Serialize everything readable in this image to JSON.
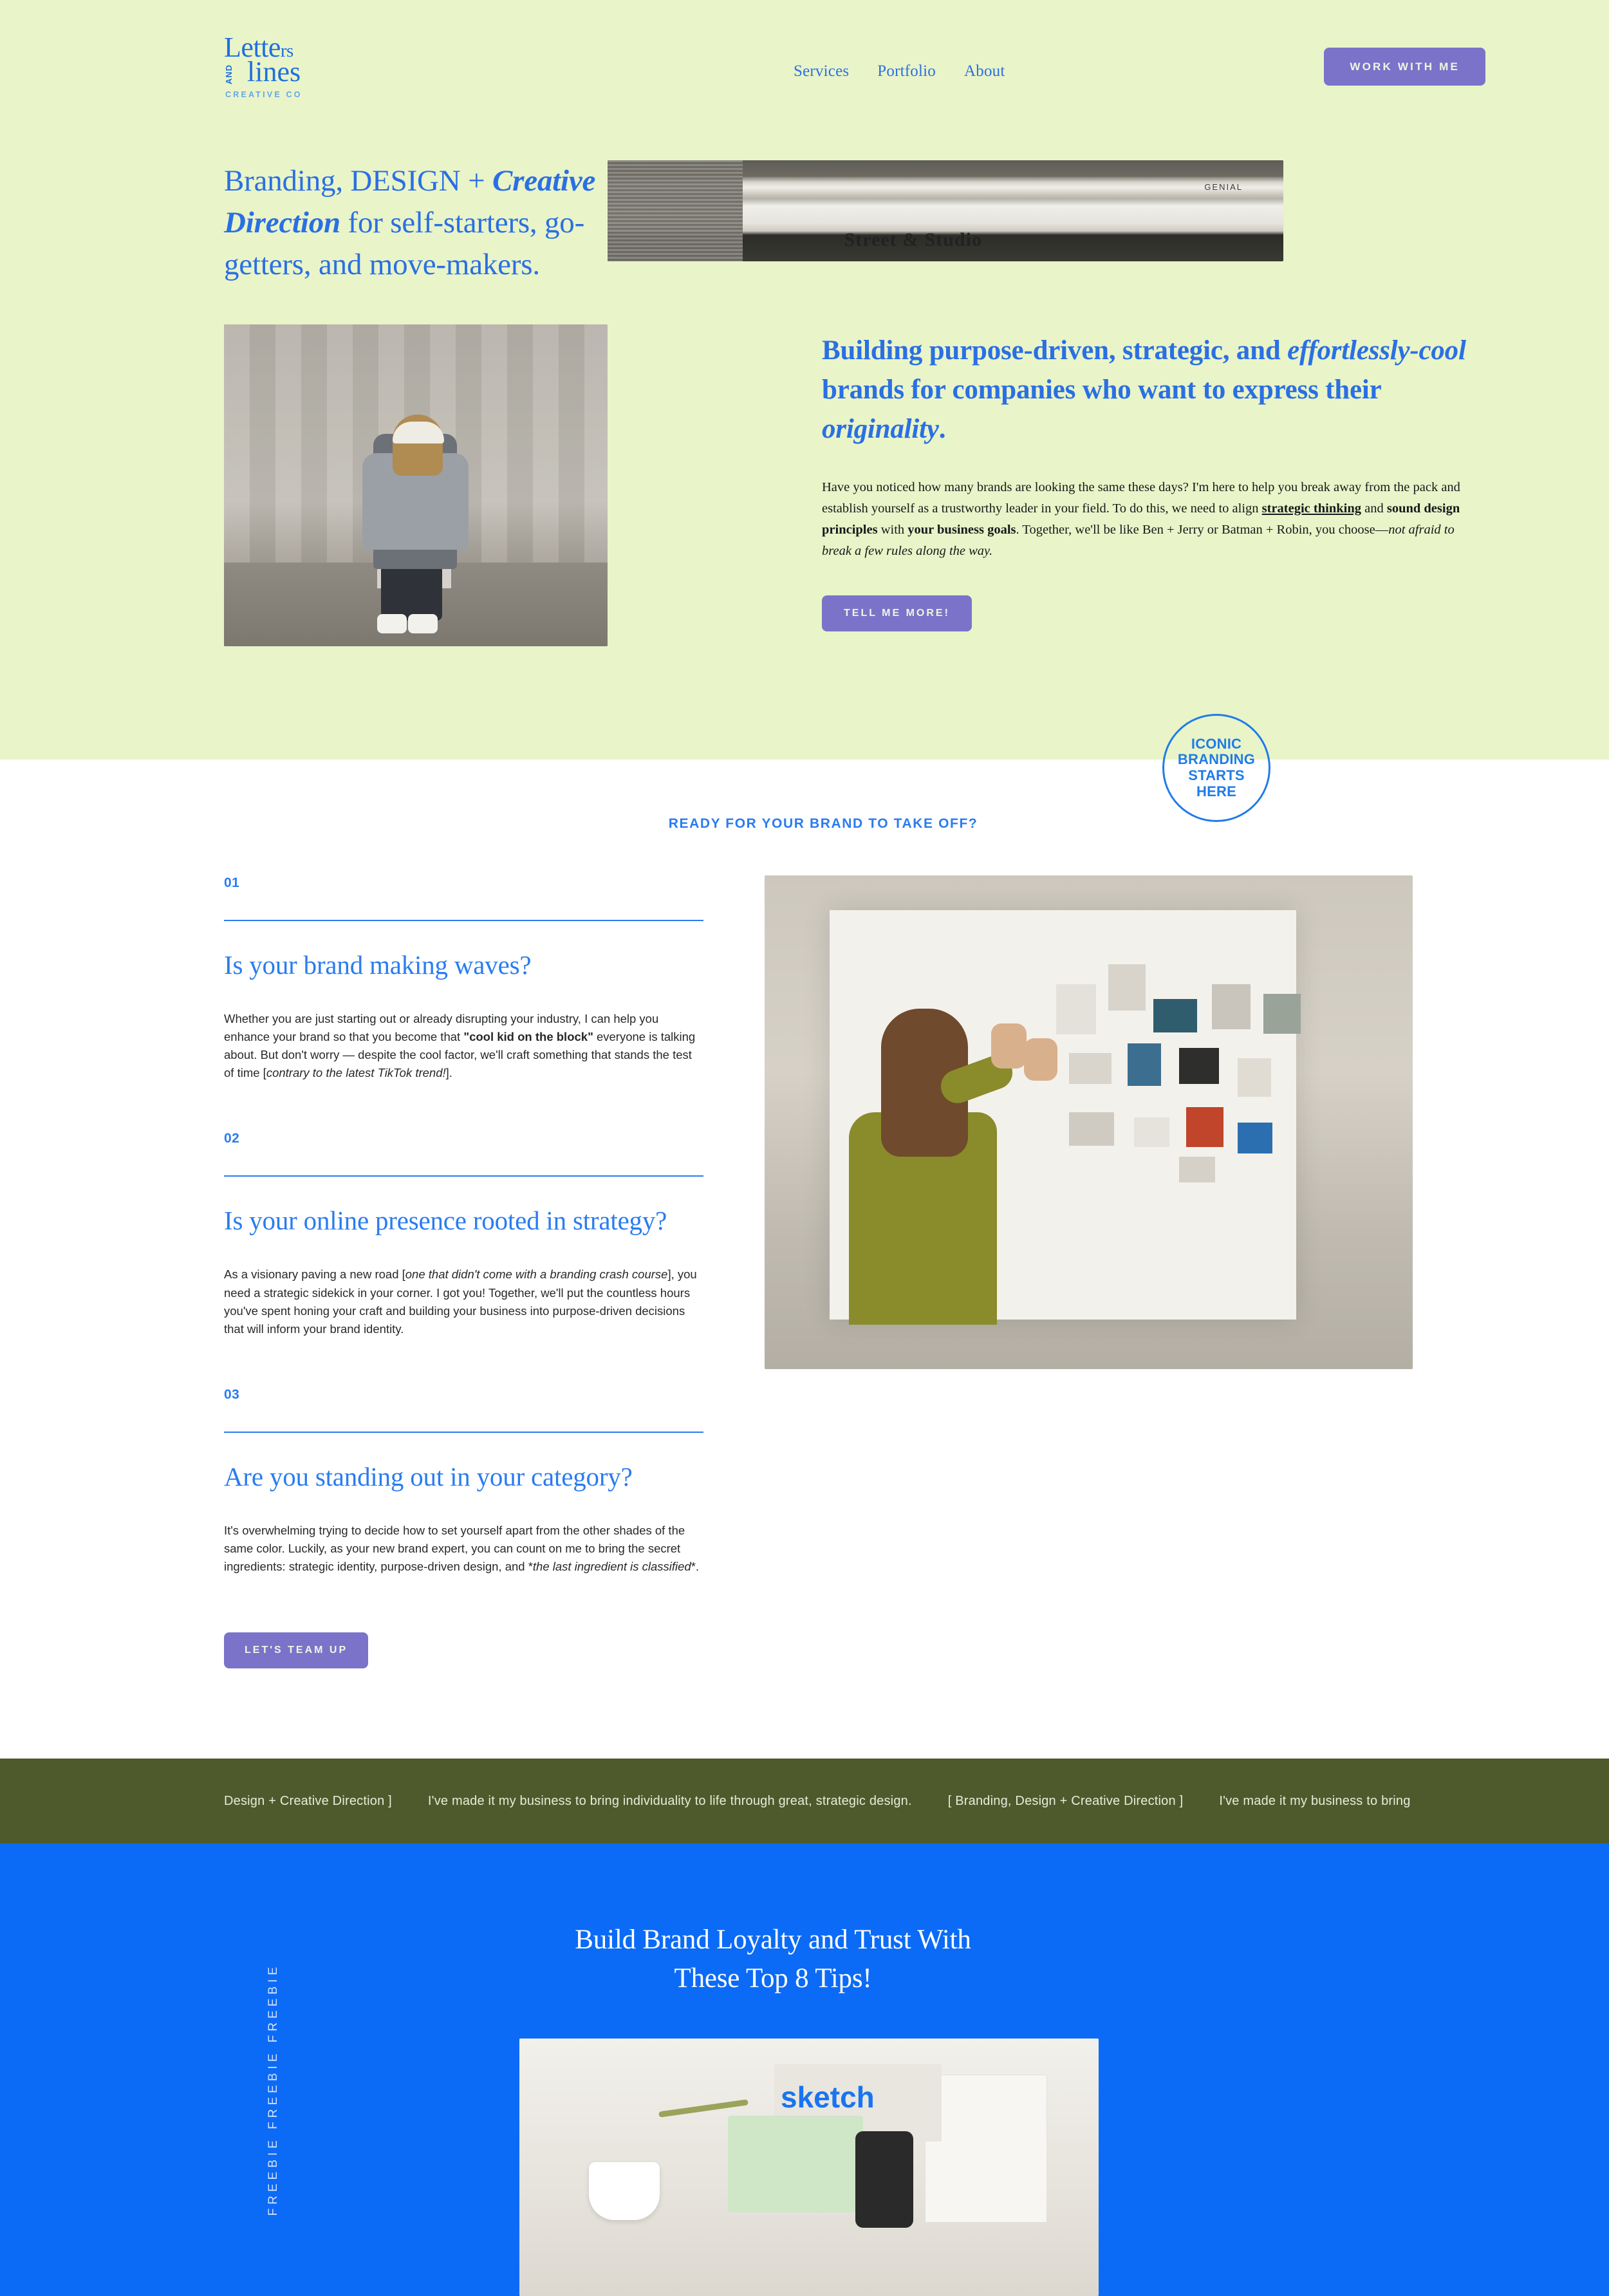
{
  "colors": {
    "hero_bg": "#e9f4c8",
    "brand_blue": "#2a6fe4",
    "bright_blue": "#0b6bf7",
    "purple_button": "#7b73c9",
    "olive_bar": "#4e5a2c",
    "white": "#ffffff"
  },
  "header": {
    "logo": {
      "line1": "Lette",
      "line1_small": "rs",
      "and": "AND",
      "line2": "lines",
      "subtitle": "CREATIVE CO"
    },
    "nav": [
      {
        "label": "Services"
      },
      {
        "label": "Portfolio"
      },
      {
        "label": "About"
      }
    ],
    "cta": "WORK WITH ME"
  },
  "hero": {
    "headline_part1": "Branding, DESIGN + ",
    "headline_italic1": "Creative Direction",
    "headline_part2": " for self-starters, go-getters, and move-makers.",
    "image_top_label": "Street & Studio",
    "image_top_label2": "GENIAL",
    "subheading_part1": "Building purpose-driven, strategic, and ",
    "subheading_italic1": "effortlessly-cool",
    "subheading_part2": " brands for companies who want to express their ",
    "subheading_italic2": "originality",
    "subheading_part3": ".",
    "paragraph": {
      "t1": "Have you noticed how many brands are looking the same these days? I'm here to help you break away from the pack and establish yourself as a trustworthy leader in your field. To do this, we need to align ",
      "b1": "strategic thinking",
      "t2": " and ",
      "b2": "sound design principles",
      "t3": " with ",
      "b3": "your business goals",
      "t4": ". Together, we'll be like Ben + Jerry or Batman + Robin, you choose—",
      "i1": "not afraid to break a few rules along the way."
    },
    "cta": "TELL ME MORE!"
  },
  "badge": {
    "line1": "ICONIC",
    "line2": "BRANDING",
    "line3": "STARTS",
    "line4": "HERE"
  },
  "services": {
    "eyebrow": "READY FOR YOUR BRAND TO TAKE OFF?",
    "items": [
      {
        "number": "01",
        "title": "Is your brand making waves?",
        "body": {
          "t1": "Whether you are just starting out or already disrupting your industry, I can help you enhance your brand so that you become that ",
          "b1": "\"cool kid on the block\"",
          "t2": " everyone is talking about. But don't worry — despite the cool factor, we'll craft something that stands the test of time [",
          "i1": "contrary to the latest TikTok trend!",
          "t3": "]."
        }
      },
      {
        "number": "02",
        "title": "Is your online presence rooted in strategy?",
        "body": {
          "t1": "As a visionary paving a new road [",
          "i1": "one that didn't come with a branding crash course",
          "t2": "], you need a strategic sidekick in your corner. I got you! Together, we'll put the countless hours you've spent honing your craft and building your business into purpose-driven decisions that will inform your brand identity."
        }
      },
      {
        "number": "03",
        "title": "Are you standing out in your category?",
        "body": {
          "t1": "It's overwhelming trying to decide how to set yourself apart from the other shades of the same color. Luckily, as your new brand expert, you can count on me to bring the secret ingredients: strategic identity, purpose-driven design, and *",
          "i1": "the last ingredient is classified",
          "t2": "*."
        }
      }
    ],
    "cta": "LET'S TEAM UP"
  },
  "marquee": {
    "items": [
      "Design + Creative Direction ]",
      "I've made it my business to bring individuality to life through great, strategic design.",
      "[ Branding, Design + Creative Direction ]",
      "I've made it my business to bring"
    ]
  },
  "freebie": {
    "vertical_label": "FREEBIE  FREEBIE  FREEBIE",
    "heading_line1": "Build Brand Loyalty and Trust With",
    "heading_line2": "These Top 8 Tips!",
    "image_label": "sketch"
  }
}
